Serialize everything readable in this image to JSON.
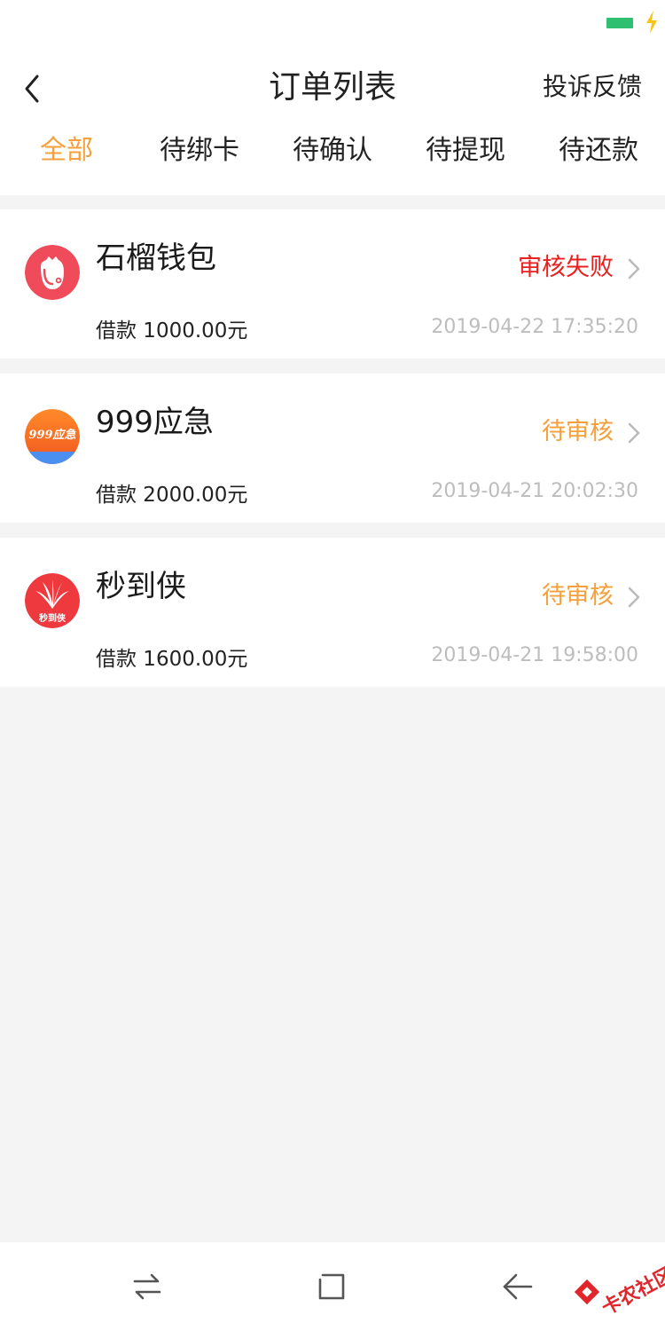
{
  "header": {
    "title": "订单列表",
    "feedback_label": "投诉反馈"
  },
  "tabs": [
    {
      "label": "全部",
      "active": true
    },
    {
      "label": "待绑卡",
      "active": false
    },
    {
      "label": "待确认",
      "active": false
    },
    {
      "label": "待提现",
      "active": false
    },
    {
      "label": "待还款",
      "active": false
    }
  ],
  "orders": [
    {
      "name": "石榴钱包",
      "status": "审核失败",
      "status_color": "#e8201f",
      "amount": "借款 1000.00元",
      "time": "2019-04-22 17:35:20",
      "logo_icon": "pomegranate-icon"
    },
    {
      "name": "999应急",
      "status": "待审核",
      "status_color": "#f5a03c",
      "amount": "借款 2000.00元",
      "time": "2019-04-21 20:02:30",
      "logo_icon": "999-logo-icon",
      "logo_text": "999应急"
    },
    {
      "name": "秒到侠",
      "status": "待审核",
      "status_color": "#f5a03c",
      "amount": "借款 1600.00元",
      "time": "2019-04-21 19:58:00",
      "logo_icon": "miaodaoxia-logo-icon",
      "logo_text": "秒到侠"
    }
  ],
  "watermark": {
    "text": "卡农社区"
  },
  "colors": {
    "accent": "#f5a03c",
    "error": "#e8201f",
    "time_gray": "#bdbdbd",
    "battery": "#2fbf71"
  }
}
